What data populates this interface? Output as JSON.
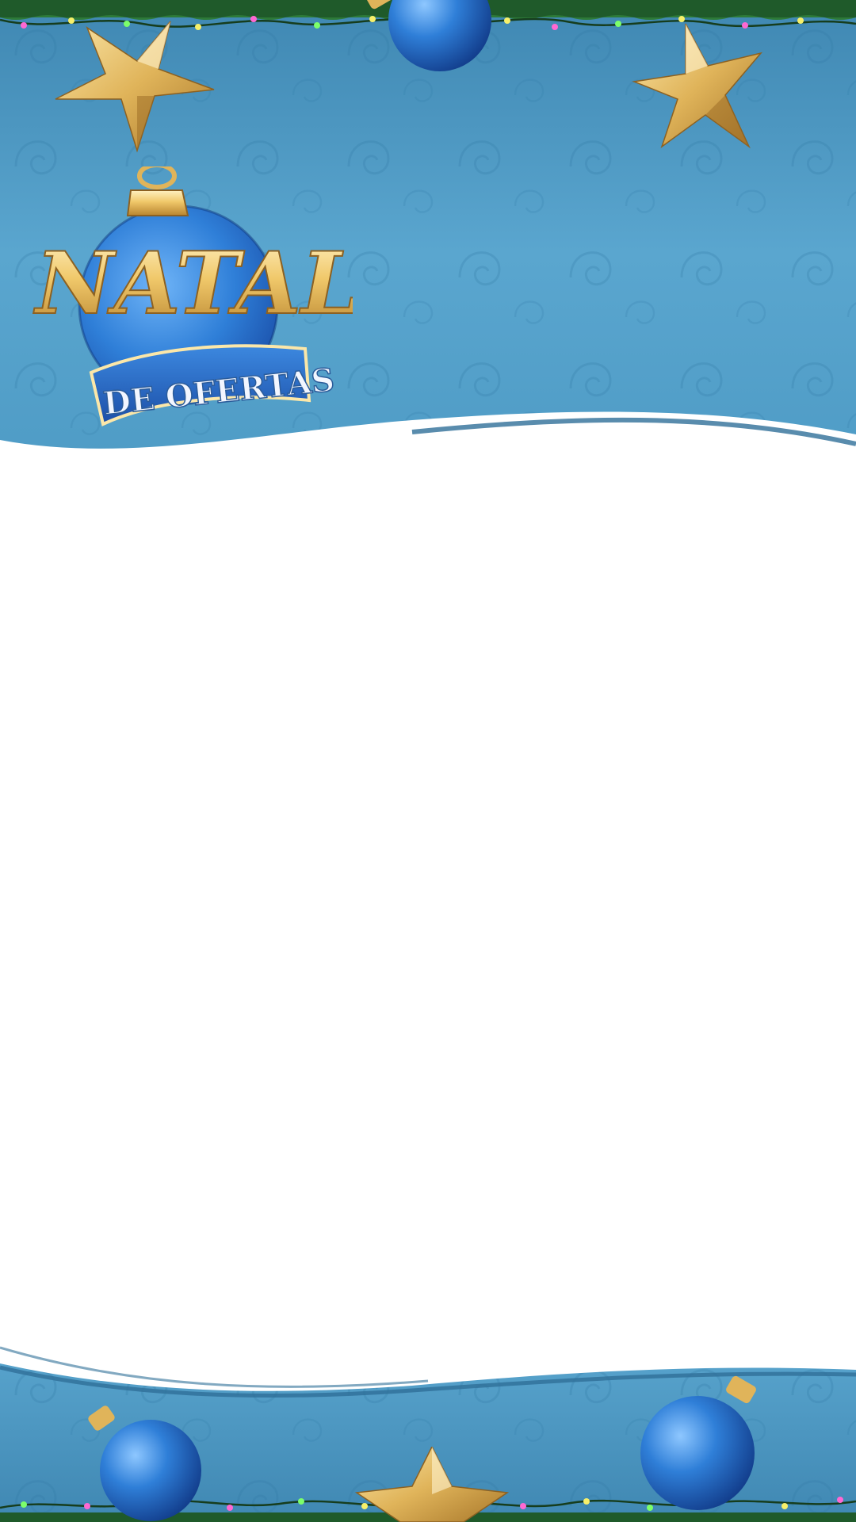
{
  "logo": {
    "title": "NATAL",
    "subtitle": "DE OFERTAS"
  },
  "colors": {
    "background_blue": "#4f9cc6",
    "background_blue_dark": "#3f87b2",
    "wave_white": "#ffffff",
    "wave_stroke": "#2f6f98",
    "gold_light": "#fbe7a9",
    "gold": "#e0b45a",
    "gold_dark": "#a8772a",
    "ornament_blue": "#2f7fd8",
    "ornament_blue_dark": "#1a4ea8",
    "garland_green": "#1f5a2a",
    "light_yellow": "#f7f06a",
    "light_pink": "#ff68d2",
    "light_green": "#7cff6a"
  },
  "decorations": {
    "icons": [
      "star-icon",
      "christmas-ornament-icon",
      "garland-icon",
      "string-lights-icon"
    ]
  },
  "content_area": {
    "text": ""
  }
}
